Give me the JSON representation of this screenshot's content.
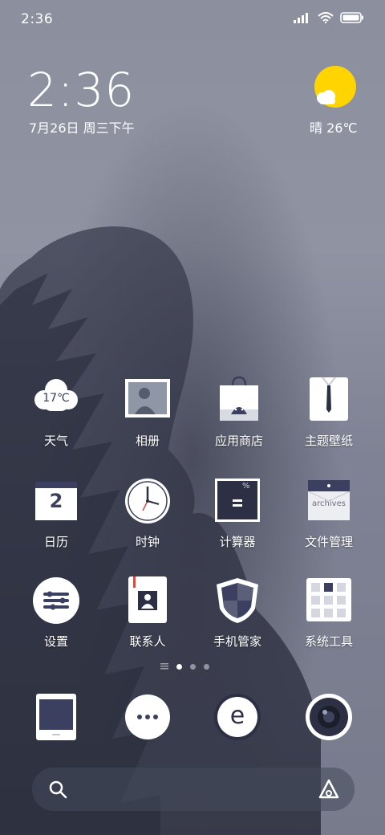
{
  "status_bar": {
    "time": "2:36"
  },
  "clock_widget": {
    "time": "2:36",
    "date": "7月26日 周三下午",
    "weather": "晴 26℃"
  },
  "apps": {
    "row1": [
      {
        "label": "天气",
        "icon": "weather-icon",
        "icon_text": "17℃"
      },
      {
        "label": "相册",
        "icon": "gallery-icon"
      },
      {
        "label": "应用商店",
        "icon": "app-store-icon"
      },
      {
        "label": "主题壁纸",
        "icon": "themes-icon"
      }
    ],
    "row2": [
      {
        "label": "日历",
        "icon": "calendar-icon",
        "icon_text": "2"
      },
      {
        "label": "时钟",
        "icon": "clock-icon"
      },
      {
        "label": "计算器",
        "icon": "calculator-icon",
        "icon_text": "%"
      },
      {
        "label": "文件管理",
        "icon": "file-manager-icon",
        "icon_text": "archives"
      }
    ],
    "row3": [
      {
        "label": "设置",
        "icon": "settings-icon"
      },
      {
        "label": "联系人",
        "icon": "contacts-icon"
      },
      {
        "label": "手机管家",
        "icon": "security-icon"
      },
      {
        "label": "系统工具",
        "icon": "tools-icon"
      }
    ]
  },
  "page_indicator": {
    "pages": 3,
    "current": 1
  },
  "dock": [
    {
      "name": "phone-icon"
    },
    {
      "name": "messages-icon"
    },
    {
      "name": "browser-icon",
      "icon_text": "e"
    },
    {
      "name": "camera-icon"
    }
  ],
  "colors": {
    "weather_sun": "#ffd400",
    "icon_navy": "#3c4060",
    "accent_red": "#e0483a"
  }
}
